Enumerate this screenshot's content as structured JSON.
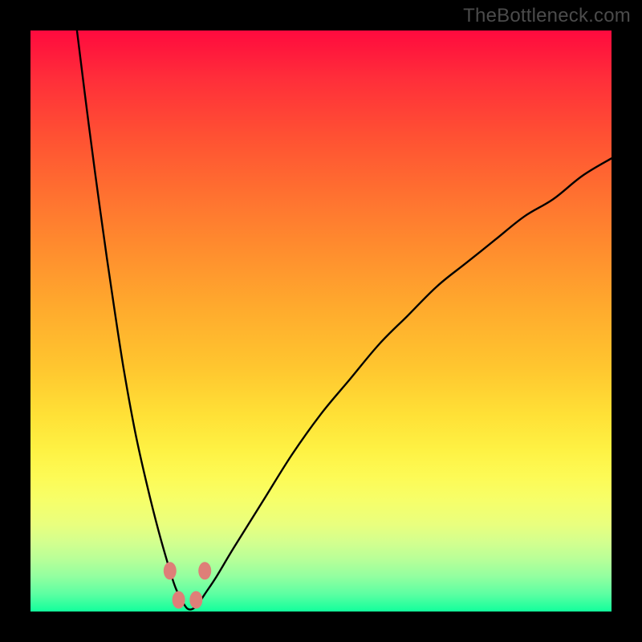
{
  "watermark": "TheBottleneck.com",
  "colors": {
    "background": "#000000",
    "curve": "#000000",
    "marker": "#de7f78"
  },
  "chart_data": {
    "type": "line",
    "title": "",
    "xlabel": "",
    "ylabel": "",
    "xlim": [
      0,
      100
    ],
    "ylim": [
      0,
      100
    ],
    "grid": false,
    "legend": false,
    "annotations": [],
    "notes": "V-shaped bottleneck curve. x is a normalized parameter (0–100 across plot width). y is bottleneck percentage (0 at bottom / green = no bottleneck, 100 at top / red = full bottleneck). Curve minimum near x≈27 where y≈0. Left branch rises steeply to y=100 at x≈8. Right branch rises with decreasing slope toward y≈78 at x=100. Four salmon markers sit near the trough.",
    "series": [
      {
        "name": "bottleneck-curve",
        "x": [
          8,
          10,
          12,
          14,
          16,
          18,
          20,
          22,
          24,
          25,
          26,
          27,
          28,
          29,
          30,
          32,
          35,
          40,
          45,
          50,
          55,
          60,
          65,
          70,
          75,
          80,
          85,
          90,
          95,
          100
        ],
        "y": [
          100,
          84,
          69,
          55,
          42,
          31,
          22,
          14,
          7,
          4,
          2,
          0.5,
          0.5,
          1.5,
          3,
          6,
          11,
          19,
          27,
          34,
          40,
          46,
          51,
          56,
          60,
          64,
          68,
          71,
          75,
          78
        ]
      }
    ],
    "markers": [
      {
        "x": 24.0,
        "y": 7.0
      },
      {
        "x": 25.5,
        "y": 2.0
      },
      {
        "x": 28.5,
        "y": 2.0
      },
      {
        "x": 30.0,
        "y": 7.0
      }
    ]
  }
}
